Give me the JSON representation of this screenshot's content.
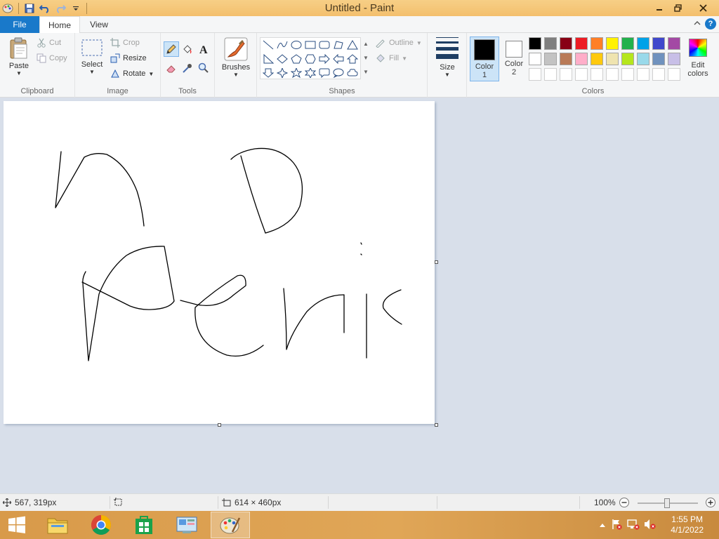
{
  "window": {
    "title": "Untitled - Paint"
  },
  "quick_access": {
    "items": [
      "paint-menu-icon",
      "save-icon",
      "undo-icon",
      "redo-icon",
      "customize-icon"
    ]
  },
  "tabs": {
    "file": "File",
    "home": "Home",
    "view": "View"
  },
  "clipboard": {
    "paste": "Paste",
    "cut": "Cut",
    "copy": "Copy",
    "label": "Clipboard"
  },
  "image": {
    "select": "Select",
    "crop": "Crop",
    "resize": "Resize",
    "rotate": "Rotate",
    "label": "Image"
  },
  "tools": {
    "label": "Tools",
    "active": "pencil"
  },
  "brushes": {
    "label": "Brushes"
  },
  "shapes": {
    "outline": "Outline",
    "fill": "Fill",
    "label": "Shapes"
  },
  "size": {
    "label": "Size"
  },
  "color1": {
    "label": "Color",
    "num": "1",
    "value": "#000000"
  },
  "color2": {
    "label": "Color",
    "num": "2",
    "value": "#ffffff"
  },
  "colors": {
    "label": "Colors",
    "row1": [
      "#000000",
      "#7f7f7f",
      "#880015",
      "#ed1c24",
      "#ff7f27",
      "#fff200",
      "#22b14c",
      "#00a2e8",
      "#3f48cc",
      "#a349a4"
    ],
    "row2": [
      "#ffffff",
      "#c3c3c3",
      "#b97a57",
      "#ffaec9",
      "#ffc90e",
      "#efe4b0",
      "#b5e61d",
      "#99d9ea",
      "#7092be",
      "#c8bfe7"
    ],
    "row3": [
      "#ffffff",
      "#ffffff",
      "#ffffff",
      "#ffffff",
      "#ffffff",
      "#ffffff",
      "#ffffff",
      "#ffffff",
      "#ffffff",
      "#ffffff"
    ]
  },
  "edit_colors": {
    "line1": "Edit",
    "line2": "colors"
  },
  "status": {
    "cursor_pos": "567, 319px",
    "selection": "",
    "canvas_size": "614 × 460px",
    "zoom": "100%"
  },
  "taskbar": {
    "items": [
      "start-button",
      "file-explorer",
      "chrome",
      "store",
      "control-panel",
      "paint"
    ],
    "time": "1:55 PM",
    "date": "4/1/2022"
  }
}
